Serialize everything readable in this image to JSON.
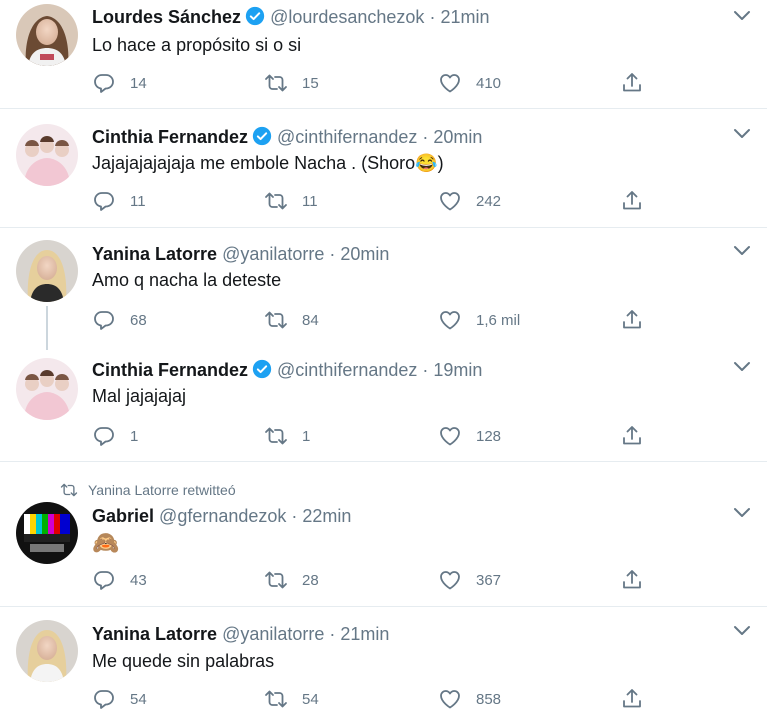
{
  "tweets": [
    {
      "name": "Lourdes Sánchez",
      "verified": true,
      "handle": "@lourdesanchezok",
      "time": "21min",
      "text": "Lo hace a propósito si o si",
      "replies": "14",
      "retweets": "15",
      "likes": "410"
    },
    {
      "name": "Cinthia Fernandez",
      "verified": true,
      "handle": "@cinthifernandez",
      "time": "20min",
      "text": "Jajajajajajaja me embole Nacha . (Shoro😂)",
      "replies": "11",
      "retweets": "11",
      "likes": "242"
    },
    {
      "name": "Yanina Latorre",
      "verified": false,
      "handle": "@yanilatorre",
      "time": "20min",
      "text": "Amo q nacha la deteste",
      "replies": "68",
      "retweets": "84",
      "likes": "1,6 mil"
    },
    {
      "name": "Cinthia Fernandez",
      "verified": true,
      "handle": "@cinthifernandez",
      "time": "19min",
      "text": "Mal jajajajaj",
      "replies": "1",
      "retweets": "1",
      "likes": "128"
    },
    {
      "retweeted_by": "Yanina Latorre retwitteó",
      "name": "Gabriel",
      "verified": false,
      "handle": "@gfernandezok",
      "time": "22min",
      "text": "🙈",
      "replies": "43",
      "retweets": "28",
      "likes": "367"
    },
    {
      "name": "Yanina Latorre",
      "verified": false,
      "handle": "@yanilatorre",
      "time": "21min",
      "text": "Me quede sin palabras",
      "replies": "54",
      "retweets": "54",
      "likes": "858"
    }
  ],
  "separator_dot": "·",
  "colors": {
    "verified": "#1da1f2",
    "secondary_text": "#657786",
    "separator": "#e6ecf0"
  },
  "icons": {
    "reply": "reply-icon",
    "retweet": "retweet-icon",
    "like": "like-icon",
    "share": "share-icon",
    "caret": "chevron-down-icon",
    "verified": "verified-badge-icon"
  }
}
